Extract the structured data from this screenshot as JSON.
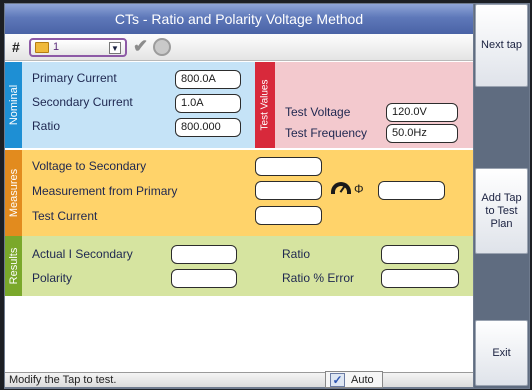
{
  "window": {
    "title": "CTs - Ratio and Polarity Voltage Method"
  },
  "toolbar": {
    "hash": "#",
    "tap_value": "1",
    "dropdown_arrow": "▼",
    "check_glyph": "✔"
  },
  "nominal": {
    "section_label": "Nominal",
    "primary_current_label": "Primary Current",
    "primary_current_value": "800.0A",
    "secondary_current_label": "Secondary Current",
    "secondary_current_value": "1.0A",
    "ratio_label": "Ratio",
    "ratio_value": "800.000"
  },
  "test_values": {
    "section_label": "Test Values",
    "test_voltage_label": "Test Voltage",
    "test_voltage_value": "120.0V",
    "test_frequency_label": "Test Frequency",
    "test_frequency_value": "50.0Hz"
  },
  "measures": {
    "section_label": "Measures",
    "voltage_to_secondary_label": "Voltage to Secondary",
    "voltage_to_secondary_value": "",
    "measurement_from_primary_label": "Measurement from Primary",
    "measurement_from_primary_value": "",
    "phi_label": "Φ",
    "phase_value": "",
    "test_current_label": "Test Current",
    "test_current_value": ""
  },
  "results": {
    "section_label": "Results",
    "actual_secondary_label": "Actual I Secondary",
    "actual_secondary_value": "",
    "ratio_label": "Ratio",
    "ratio_value": "",
    "polarity_label": "Polarity",
    "polarity_value": "",
    "ratio_error_label": "Ratio % Error",
    "ratio_error_value": ""
  },
  "status": {
    "message": "Modify the Tap to test.",
    "auto_label": "Auto",
    "auto_checked": true
  },
  "sidebar": {
    "next_tap": "Next tap",
    "add_tap": "Add Tap to Test Plan",
    "exit": "Exit"
  },
  "colors": {
    "nominal": "#1e8fd4",
    "test_values": "#d8293b",
    "measures": "#e28b1e",
    "results": "#7aa82b"
  }
}
